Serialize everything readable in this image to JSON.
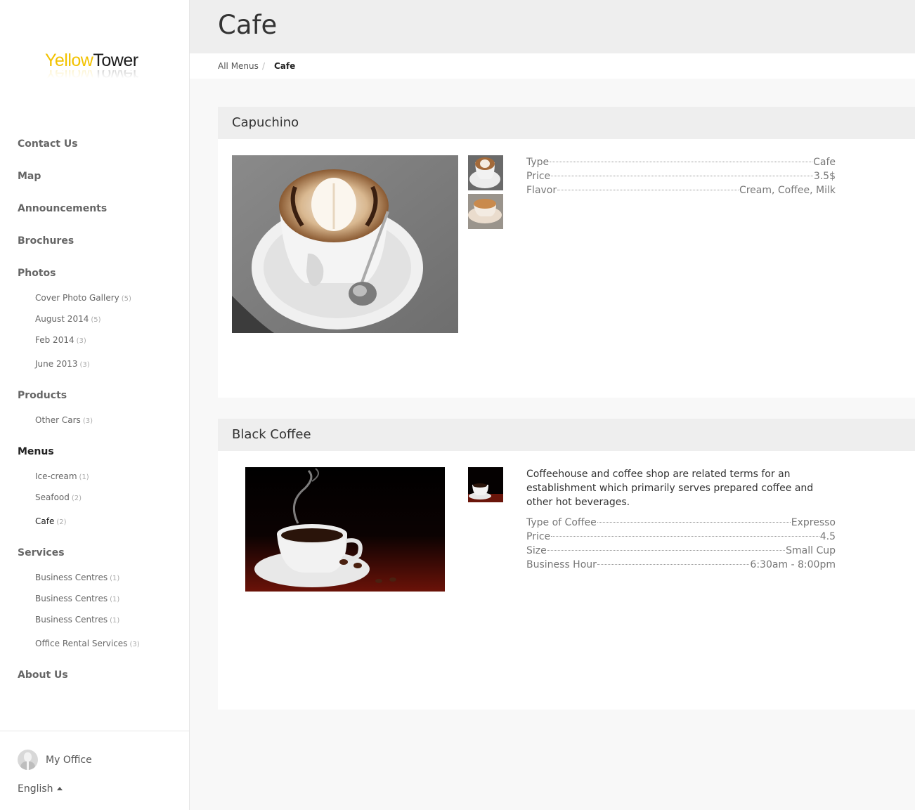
{
  "brand": {
    "name_part1": "Yellow",
    "name_part2": "Tower",
    "accent_color": "#f2c200"
  },
  "sidebar": {
    "sections": [
      {
        "label": "Contact Us",
        "items": []
      },
      {
        "label": "Map",
        "items": []
      },
      {
        "label": "Announcements",
        "items": []
      },
      {
        "label": "Brochures",
        "items": []
      },
      {
        "label": "Photos",
        "items": [
          {
            "label": "Cover Photo Gallery",
            "count": "(5)"
          },
          {
            "label": "August 2014",
            "count": "(5)"
          },
          {
            "label": "Feb 2014",
            "count": "(3)"
          },
          {
            "label": "June 2013",
            "count": "(3)"
          }
        ]
      },
      {
        "label": "Products",
        "items": [
          {
            "label": "Other Cars",
            "count": "(3)"
          }
        ]
      },
      {
        "label": "Menus",
        "active": true,
        "items": [
          {
            "label": "Ice-cream",
            "count": "(1)"
          },
          {
            "label": "Seafood",
            "count": "(2)"
          },
          {
            "label": "Cafe",
            "count": "(2)",
            "active": true
          }
        ]
      },
      {
        "label": "Services",
        "items": [
          {
            "label": "Business Centres",
            "count": "(1)"
          },
          {
            "label": "Business Centres",
            "count": "(1)"
          },
          {
            "label": "Business Centres",
            "count": "(1)"
          },
          {
            "label": "Office Rental Services",
            "count": "(3)"
          }
        ]
      },
      {
        "label": "About Us",
        "items": []
      }
    ],
    "footer": {
      "office_label": "My Office",
      "language": "English"
    }
  },
  "header": {
    "title": "Cafe"
  },
  "breadcrumb": {
    "parent": "All Menus",
    "separator": "/",
    "current": "Cafe"
  },
  "items": [
    {
      "title": "Capuchino",
      "description": "",
      "thumbnails": [
        "latte-art-cup",
        "cappuccino-cup"
      ],
      "details": [
        {
          "label": "Type",
          "value": "Cafe"
        },
        {
          "label": "Price",
          "value": "3.5$"
        },
        {
          "label": "Flavor",
          "value": "Cream, Coffee, Milk"
        }
      ]
    },
    {
      "title": "Black Coffee",
      "description": "Coffeehouse and coffee shop are related terms for an establishment which primarily serves prepared coffee and other hot beverages.",
      "thumbnails": [
        "black-coffee-cup"
      ],
      "details": [
        {
          "label": "Type of Coffee",
          "value": "Expresso"
        },
        {
          "label": "Price",
          "value": "4.5"
        },
        {
          "label": "Size",
          "value": "Small Cup"
        },
        {
          "label": "Business Hour",
          "value": "6:30am - 8:00pm"
        }
      ]
    }
  ]
}
